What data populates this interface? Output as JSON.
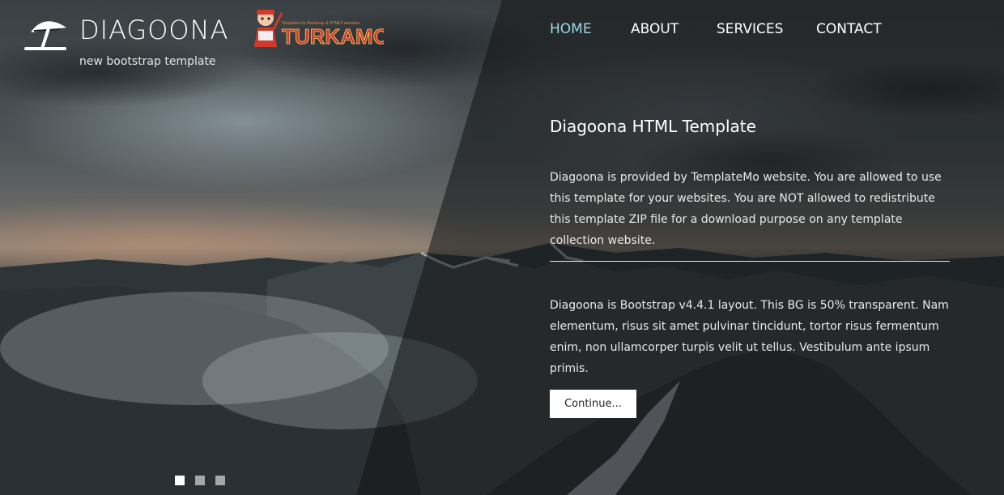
{
  "brand": {
    "name": "DIAGOONA",
    "tagline": "new bootstrap template",
    "icon": "beach-umbrella-icon"
  },
  "badge": {
    "text": "TURKAMO",
    "subtitle": "Templates for Bootstrap & HTML5 websites",
    "icon": "mascot-icon"
  },
  "nav": {
    "items": [
      {
        "label": "HOME",
        "active": true
      },
      {
        "label": "ABOUT",
        "active": false
      },
      {
        "label": "SERVICES",
        "active": false
      },
      {
        "label": "CONTACT",
        "active": false
      }
    ]
  },
  "content": {
    "heading": "Diagoona HTML Template",
    "paragraph1": "Diagoona is provided by TemplateMo website. You are allowed to use this template for your websites. You are NOT allowed to redistribute this template ZIP file for a download purpose on any template collection website.",
    "paragraph2": "Diagoona is Bootstrap v4.4.1 layout. This BG is 50% transparent. Nam elementum, risus sit amet pulvinar tincidunt, tortor risus fermentum enim, non ullamcorper turpis velit ut tellus. Vestibulum ante ipsum primis.",
    "button_label": "Continue..."
  },
  "slider": {
    "count": 3,
    "active_index": 0
  },
  "colors": {
    "nav_active": "#9ed8e2",
    "text": "#ffffff",
    "button_bg": "#ffffff",
    "badge_text": "#d13a2a"
  }
}
